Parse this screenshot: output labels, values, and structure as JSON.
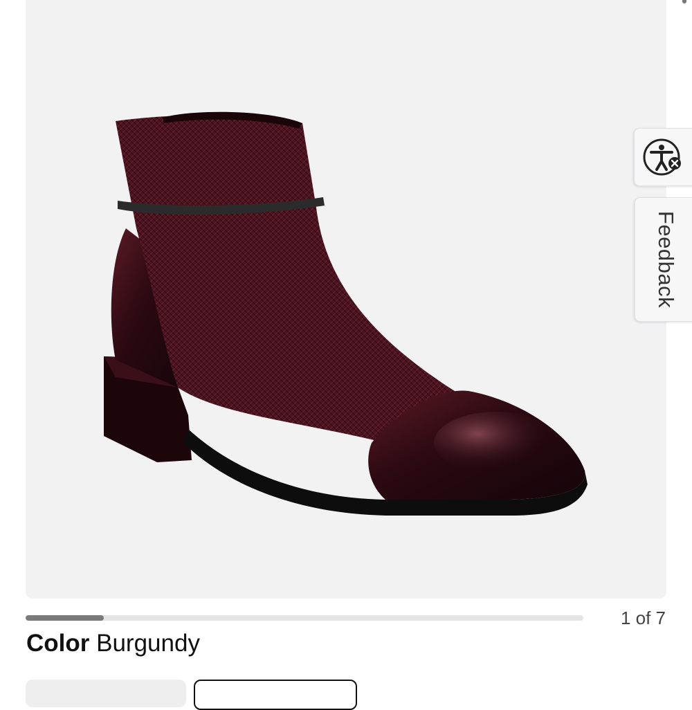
{
  "product": {
    "image_alt": "Burgundy leather ankle boot",
    "color_label": "Color",
    "color_value": "Burgundy"
  },
  "gallery": {
    "counter_text": "1 of 7",
    "progress_fraction": 0.14
  },
  "side_widgets": {
    "accessibility_icon": "accessibility-person-icon",
    "feedback_label": "Feedback"
  },
  "colors": {
    "burgundy": "#3a0f18",
    "gallery_bg": "#f2f2f3"
  }
}
